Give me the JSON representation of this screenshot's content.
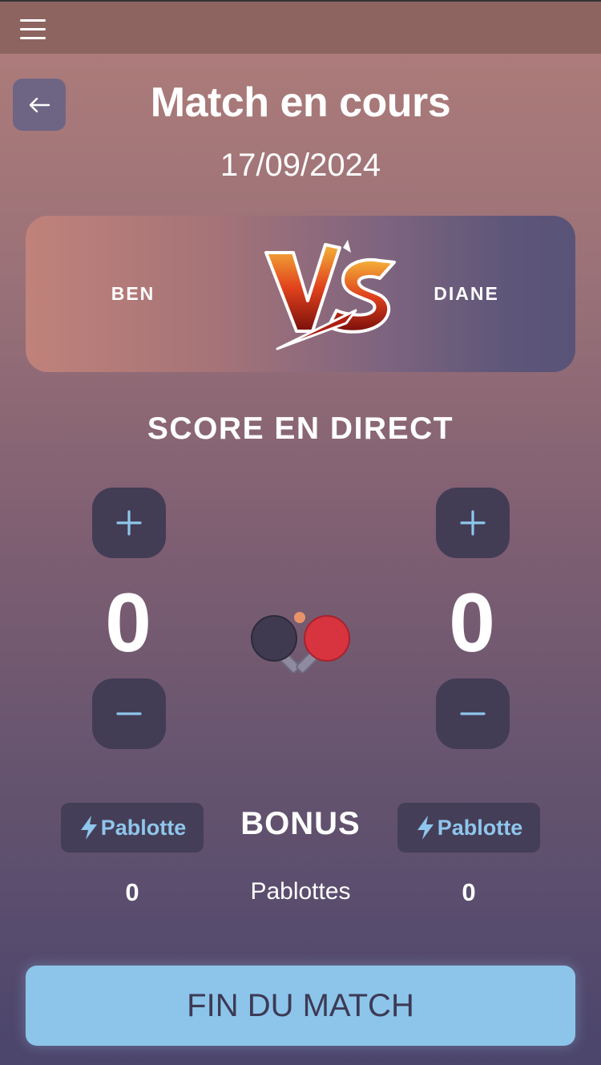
{
  "header": {
    "menu_icon": "hamburger-icon"
  },
  "page": {
    "back_icon": "arrow-left-icon",
    "title": "Match en cours",
    "date": "17/09/2024"
  },
  "versus": {
    "player1": "BEN",
    "player2": "DIANE",
    "logo_text": "VS"
  },
  "score": {
    "title": "SCORE EN DIRECT",
    "player1": "0",
    "player2": "0",
    "center_icon": "ping-pong-paddles-icon"
  },
  "bonus": {
    "label": "BONUS",
    "button_label": "Pablotte",
    "counter_label": "Pablottes",
    "player1_count": "0",
    "player2_count": "0"
  },
  "actions": {
    "end_match": "FIN DU MATCH"
  },
  "colors": {
    "accent": "#8dc5ea",
    "button_dark": "#433c55",
    "text_dark": "#3d3a55"
  }
}
